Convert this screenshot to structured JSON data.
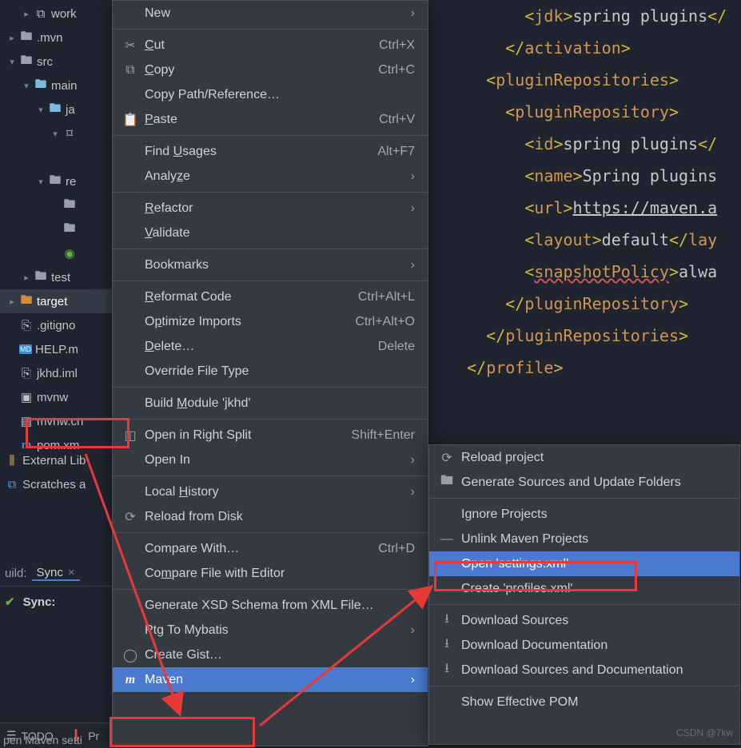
{
  "tree": {
    "items": [
      {
        "label": "work",
        "icon": "xml",
        "arrow": ">",
        "indent": 1
      },
      {
        "label": ".mvn",
        "icon": "folder",
        "arrow": ">",
        "indent": 0
      },
      {
        "label": "src",
        "icon": "folder",
        "arrow": "v",
        "indent": 0
      },
      {
        "label": "main",
        "icon": "folder-open",
        "arrow": "v",
        "indent": 1
      },
      {
        "label": "ja",
        "icon": "folder-open",
        "arrow": "v",
        "indent": 2
      },
      {
        "label": "",
        "icon": "camera",
        "arrow": "v",
        "indent": 3
      },
      {
        "label": "",
        "icon": "",
        "arrow": "",
        "indent": 4
      },
      {
        "label": "re",
        "icon": "folder-res",
        "arrow": "v",
        "indent": 2
      },
      {
        "label": "",
        "icon": "folder",
        "arrow": "",
        "indent": 3
      },
      {
        "label": "",
        "icon": "folder",
        "arrow": "",
        "indent": 3
      },
      {
        "label": "",
        "icon": "spring",
        "arrow": "",
        "indent": 3
      },
      {
        "label": "test",
        "icon": "folder",
        "arrow": ">",
        "indent": 1
      },
      {
        "label": "target",
        "icon": "folder-orange",
        "arrow": ">",
        "indent": 0,
        "selected": true
      },
      {
        "label": ".gitigno",
        "icon": "git",
        "arrow": "",
        "indent": 0
      },
      {
        "label": "HELP.m",
        "icon": "md",
        "arrow": "",
        "indent": 0
      },
      {
        "label": "jkhd.iml",
        "icon": "iml",
        "arrow": "",
        "indent": 0
      },
      {
        "label": "mvnw",
        "icon": "term",
        "arrow": "",
        "indent": 0
      },
      {
        "label": "mvnw.cn",
        "icon": "file",
        "arrow": "",
        "indent": 0
      },
      {
        "label": "pom.xm",
        "icon": "maven",
        "arrow": "",
        "indent": 0
      }
    ],
    "external": "External Lib",
    "scratches": "Scratches a"
  },
  "context": {
    "items": [
      {
        "label": "New",
        "sub": true
      },
      {
        "sep": true
      },
      {
        "label": "Cut",
        "u": 0,
        "icon": "cut",
        "short": "Ctrl+X"
      },
      {
        "label": "Copy",
        "u": 0,
        "icon": "copy",
        "short": "Ctrl+C"
      },
      {
        "label": "Copy Path/Reference…"
      },
      {
        "label": "Paste",
        "u": 0,
        "icon": "paste",
        "short": "Ctrl+V"
      },
      {
        "sep": true
      },
      {
        "label": "Find Usages",
        "u": 5,
        "short": "Alt+F7"
      },
      {
        "label": "Analyze",
        "u": 5,
        "sub": true
      },
      {
        "sep": true
      },
      {
        "label": "Refactor",
        "u": 0,
        "sub": true
      },
      {
        "label": "Validate",
        "u": 0
      },
      {
        "sep": true
      },
      {
        "label": "Bookmarks",
        "sub": true
      },
      {
        "sep": true
      },
      {
        "label": "Reformat Code",
        "u": 0,
        "short": "Ctrl+Alt+L"
      },
      {
        "label": "Optimize Imports",
        "u": 1,
        "short": "Ctrl+Alt+O"
      },
      {
        "label": "Delete…",
        "u": 0,
        "short": "Delete"
      },
      {
        "label": "Override File Type"
      },
      {
        "sep": true
      },
      {
        "label": "Build Module 'jkhd'",
        "u": 6
      },
      {
        "sep": true
      },
      {
        "label": "Open in Right Split",
        "icon": "split",
        "short": "Shift+Enter"
      },
      {
        "label": "Open In",
        "sub": true
      },
      {
        "sep": true
      },
      {
        "label": "Local History",
        "u": 6,
        "sub": true
      },
      {
        "label": "Reload from Disk",
        "icon": "reload"
      },
      {
        "sep": true
      },
      {
        "label": "Compare With…",
        "short": "Ctrl+D"
      },
      {
        "label": "Compare File with Editor",
        "u": 2
      },
      {
        "sep": true
      },
      {
        "label": "Generate XSD Schema from XML File…"
      },
      {
        "label": "Ptg To Mybatis",
        "sub": true
      },
      {
        "label": "Create Gist…",
        "icon": "github"
      },
      {
        "label": "Maven",
        "icon": "maven",
        "sub": true,
        "highlight": true
      }
    ]
  },
  "submenu": {
    "items": [
      {
        "label": "Reload project",
        "icon": "reload"
      },
      {
        "label": "Generate Sources and Update Folders",
        "icon": "folders"
      },
      {
        "sep": true
      },
      {
        "label": "Ignore Projects"
      },
      {
        "label": "Unlink Maven Projects",
        "icon": "minus"
      },
      {
        "label": "Open 'settings.xml'",
        "highlight": true
      },
      {
        "label": "Create 'profiles.xml'"
      },
      {
        "sep": true
      },
      {
        "label": "Download Sources",
        "icon": "download"
      },
      {
        "label": "Download Documentation",
        "icon": "download"
      },
      {
        "label": "Download Sources and Documentation",
        "icon": "download"
      },
      {
        "sep": true
      },
      {
        "label": "Show Effective POM"
      }
    ]
  },
  "editor": {
    "lines": [
      [
        {
          "t": "br",
          "v": "<"
        },
        {
          "t": "tag",
          "v": "jdk"
        },
        {
          "t": "br",
          "v": ">"
        },
        {
          "t": "txt",
          "v": "spring plugins"
        },
        {
          "t": "br",
          "v": "</"
        }
      ],
      [
        {
          "t": "br",
          "v": "</"
        },
        {
          "t": "tag",
          "v": "activation"
        },
        {
          "t": "br",
          "v": ">"
        }
      ],
      [],
      [
        {
          "t": "br",
          "v": "<"
        },
        {
          "t": "tag",
          "v": "pluginRepositories"
        },
        {
          "t": "br",
          "v": ">"
        }
      ],
      [
        {
          "t": "br",
          "v": "<"
        },
        {
          "t": "tag",
          "v": "pluginRepository"
        },
        {
          "t": "br",
          "v": ">"
        }
      ],
      [
        {
          "t": "br",
          "v": "<"
        },
        {
          "t": "tag",
          "v": "id"
        },
        {
          "t": "br",
          "v": ">"
        },
        {
          "t": "txt",
          "v": "spring plugins"
        },
        {
          "t": "br",
          "v": "</"
        }
      ],
      [
        {
          "t": "br",
          "v": "<"
        },
        {
          "t": "tag",
          "v": "name"
        },
        {
          "t": "br",
          "v": ">"
        },
        {
          "t": "txt",
          "v": "Spring plugins"
        }
      ],
      [
        {
          "t": "br",
          "v": "<"
        },
        {
          "t": "tag",
          "v": "url"
        },
        {
          "t": "br",
          "v": ">"
        },
        {
          "t": "txt linked",
          "v": "https://maven.a"
        }
      ],
      [
        {
          "t": "br",
          "v": "<"
        },
        {
          "t": "tag",
          "v": "layout"
        },
        {
          "t": "br",
          "v": ">"
        },
        {
          "t": "txt",
          "v": "default"
        },
        {
          "t": "br",
          "v": "</"
        },
        {
          "t": "tag",
          "v": "lay"
        }
      ],
      [
        {
          "t": "br",
          "v": "<"
        },
        {
          "t": "tag err",
          "v": "snapshotPolicy"
        },
        {
          "t": "br",
          "v": ">"
        },
        {
          "t": "txt",
          "v": "alwa"
        }
      ],
      [
        {
          "t": "br",
          "v": "</"
        },
        {
          "t": "tag",
          "v": "pluginRepository"
        },
        {
          "t": "br",
          "v": ">"
        }
      ],
      [
        {
          "t": "br",
          "v": "</"
        },
        {
          "t": "tag",
          "v": "pluginRepositories"
        },
        {
          "t": "br",
          "v": ">"
        }
      ],
      [
        {
          "t": "br",
          "v": "</"
        },
        {
          "t": "tag",
          "v": "profile"
        },
        {
          "t": "br",
          "v": ">"
        }
      ]
    ],
    "indents": [
      4,
      3,
      0,
      2,
      3,
      4,
      4,
      4,
      4,
      4,
      3,
      2,
      1
    ]
  },
  "bottom": {
    "tab_build": "uild:",
    "tab_sync": "Sync",
    "sync_text": "Sync:"
  },
  "status": {
    "todo": "TODO",
    "problems": "Pr",
    "hint": "pen Maven setti"
  },
  "watermark": "CSDN @7kw"
}
